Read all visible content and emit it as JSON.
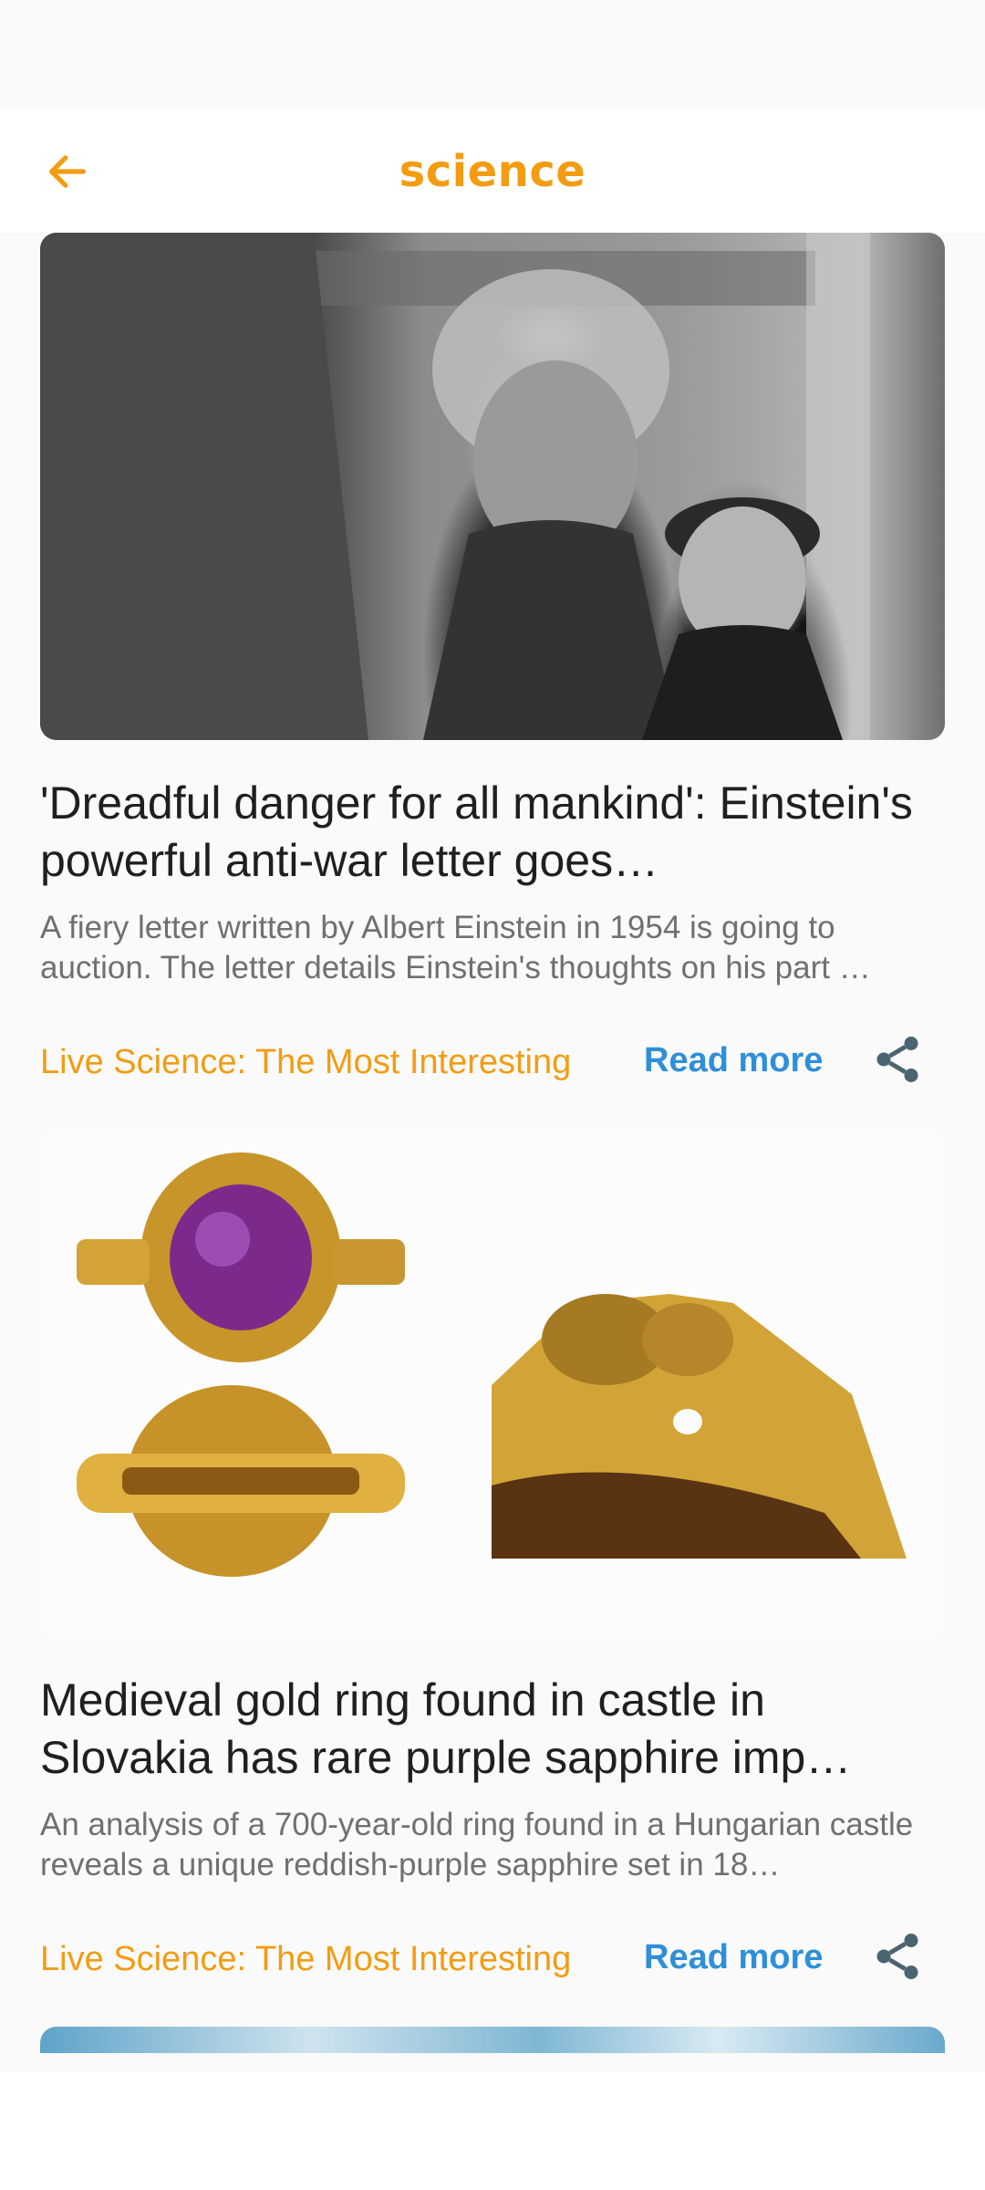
{
  "header": {
    "title": "science",
    "back_icon": "arrow-left-icon",
    "accent_color": "#f39c12"
  },
  "articles": [
    {
      "headline": "'Dreadful danger for all mankind': Einstein's powerful anti-war letter goes…",
      "summary": "A fiery letter written by Albert Einstein in 1954 is going to auction. The letter details Einstein's thoughts on his part …",
      "source": "Live Science: The Most Interesting",
      "read_more": "Read more",
      "share_icon": "share-icon"
    },
    {
      "headline": "Medieval gold ring found in castle in Slovakia has rare purple sapphire imp…",
      "summary": "An analysis of a 700-year-old ring found in a Hungarian castle reveals a unique reddish-purple sapphire set in 18…",
      "source": "Live Science: The Most Interesting",
      "read_more": "Read more",
      "share_icon": "share-icon"
    }
  ],
  "colors": {
    "source": "#f39c12",
    "read_more": "#2f8fd8",
    "headline": "#1f1f1f",
    "summary": "#707070"
  }
}
